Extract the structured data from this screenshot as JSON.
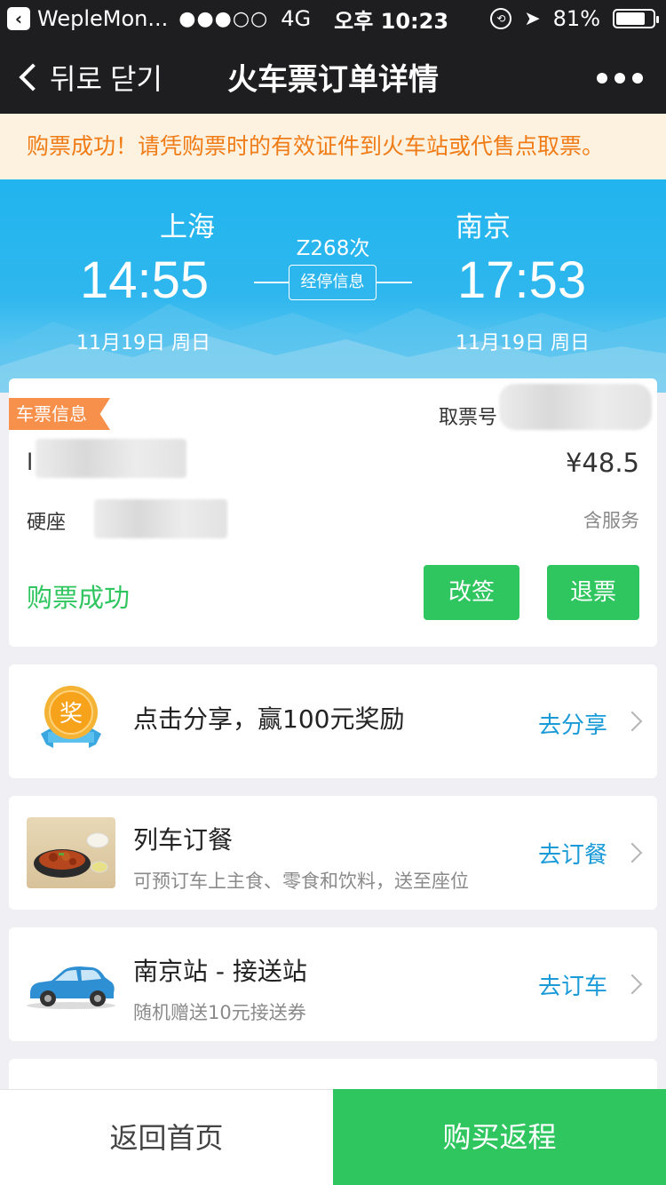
{
  "status_bar": {
    "app_name": "WepleMon...",
    "signal": "●●●○○",
    "network": "4G",
    "time": "오후 10:23",
    "battery_text": "81%",
    "battery_level": 0.81
  },
  "nav": {
    "back_label": "뒤로",
    "close_label": "닫기",
    "title": "火车票订单详情"
  },
  "notice": "购票成功！请凭购票时的有效证件到火车站或代售点取票。",
  "trip": {
    "departure_city": "上海",
    "departure_time": "14:55",
    "departure_date": "11月19日 周日",
    "arrival_city": "南京",
    "arrival_time": "17:53",
    "arrival_date": "11月19日 周日",
    "train_number": "Z268次",
    "stops_label": "经停信息"
  },
  "ticket": {
    "tag": "车票信息",
    "pickup_label": "取票号",
    "passenger_initial": "l",
    "price": "¥48.5",
    "seat_type": "硬座",
    "service_note": "含服务",
    "status": "购票成功",
    "change_label": "改签",
    "refund_label": "退票"
  },
  "promos": {
    "share": {
      "title": "点击分享，赢100元奖励",
      "action": "去分享",
      "icon_text": "奖"
    },
    "meal": {
      "title": "列车订餐",
      "subtitle": "可预订车上主食、零食和饮料，送至座位",
      "action": "去订餐"
    },
    "car": {
      "title": "南京站 - 接送站",
      "subtitle": "随机赠送10元接送券",
      "action": "去订车"
    }
  },
  "bottom": {
    "home_label": "返回首页",
    "return_label": "购买返程"
  },
  "colors": {
    "accent_green": "#2fc55f",
    "link_blue": "#1a9bd8",
    "notice_orange": "#f07c17",
    "hero_blue": "#21b4ee"
  }
}
